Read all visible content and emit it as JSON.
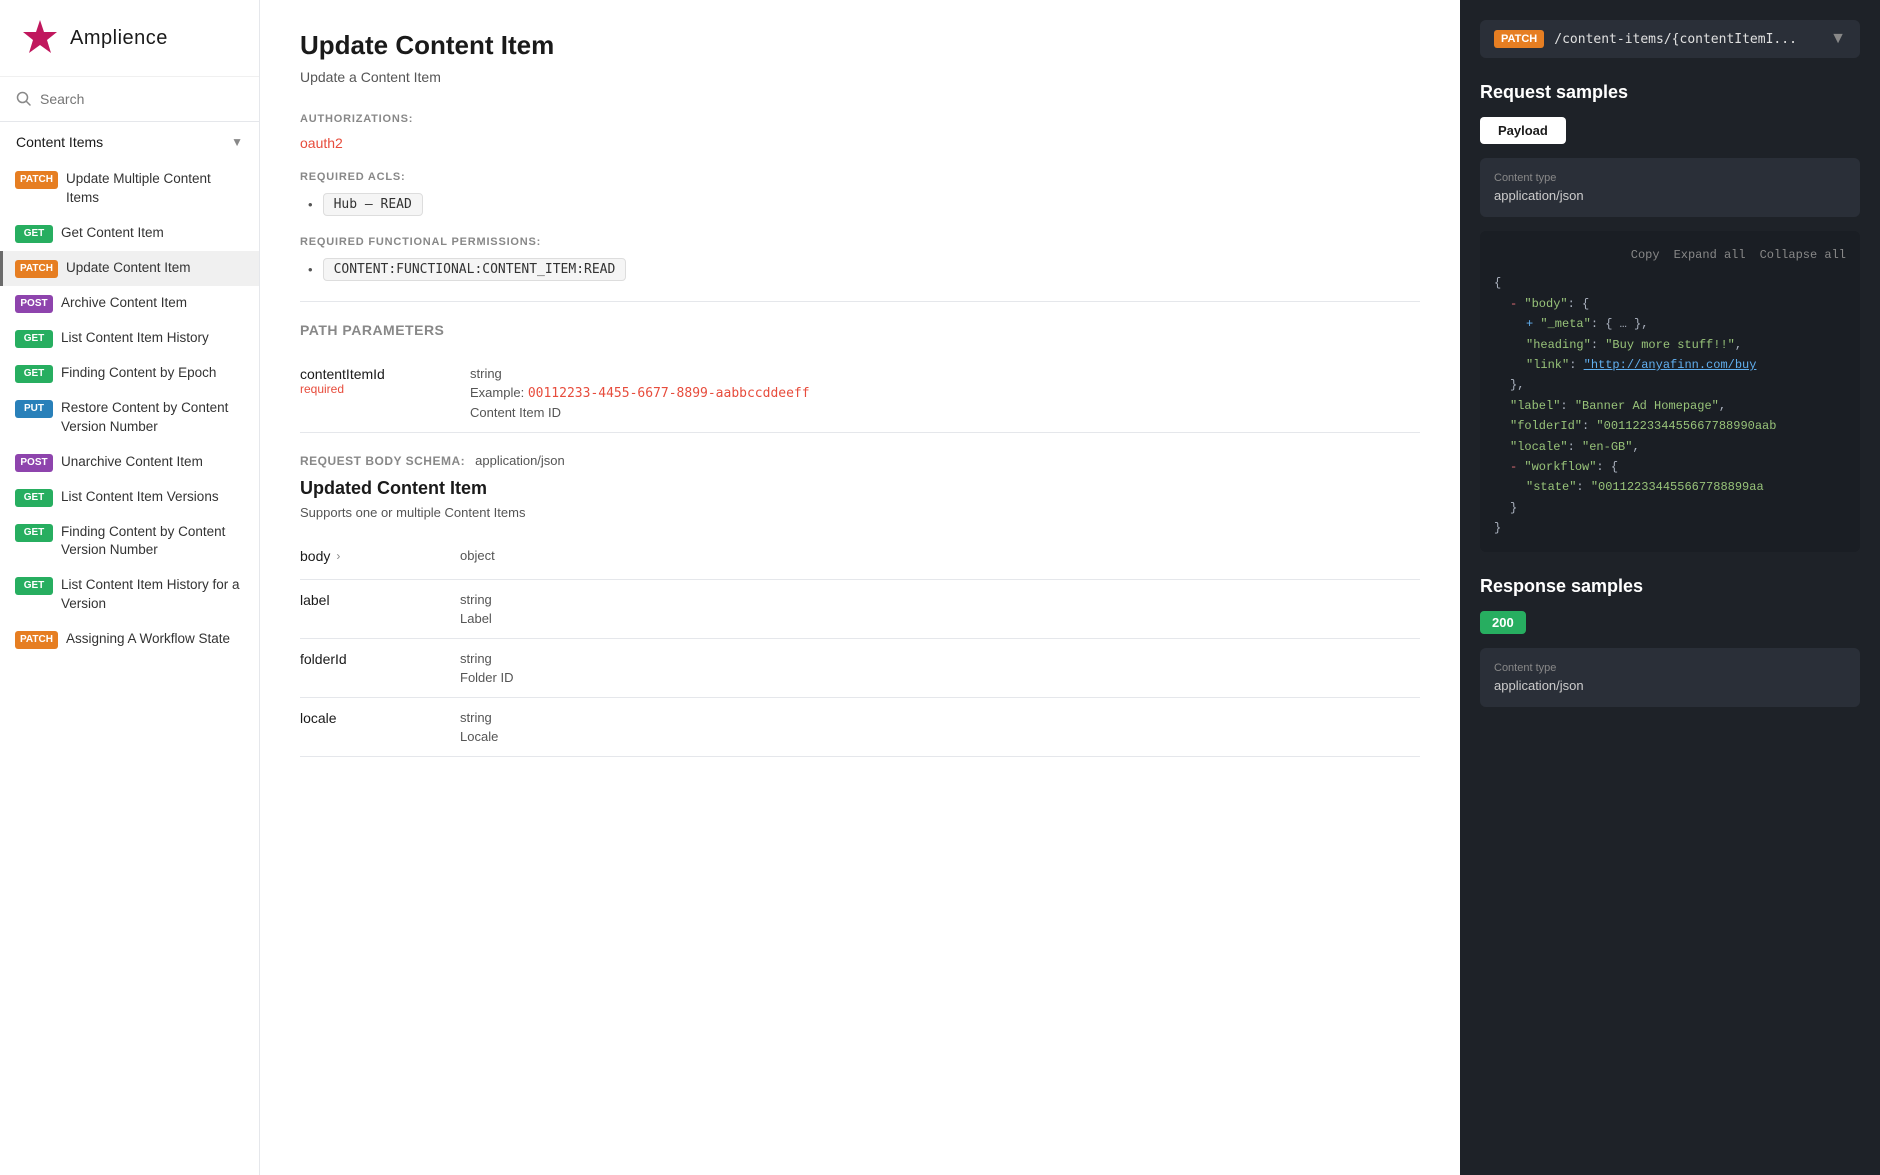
{
  "logo": {
    "text": "Amplience"
  },
  "search": {
    "placeholder": "Search",
    "label": "Search"
  },
  "sidebar": {
    "section_label": "Content Items",
    "items": [
      {
        "id": "update-multiple",
        "method": "PATCH",
        "badge": "patch",
        "label": "Update Multiple Content Items"
      },
      {
        "id": "get-content-item",
        "method": "GET",
        "badge": "get",
        "label": "Get Content Item"
      },
      {
        "id": "update-content-item",
        "method": "PATCH",
        "badge": "patch",
        "label": "Update Content Item",
        "active": true
      },
      {
        "id": "archive-content-item",
        "method": "POST",
        "badge": "post",
        "label": "Archive Content Item"
      },
      {
        "id": "list-history",
        "method": "GET",
        "badge": "get",
        "label": "List Content Item History"
      },
      {
        "id": "finding-by-epoch",
        "method": "GET",
        "badge": "get",
        "label": "Finding Content by Epoch"
      },
      {
        "id": "restore-content",
        "method": "PUT",
        "badge": "put",
        "label": "Restore Content by Content Version Number"
      },
      {
        "id": "unarchive",
        "method": "POST",
        "badge": "post",
        "label": "Unarchive Content Item"
      },
      {
        "id": "list-versions",
        "method": "GET",
        "badge": "get",
        "label": "List Content Item Versions"
      },
      {
        "id": "finding-by-version",
        "method": "GET",
        "badge": "get",
        "label": "Finding Content by Content Version Number"
      },
      {
        "id": "list-history-version",
        "method": "GET",
        "badge": "get",
        "label": "List Content Item History for a Version"
      },
      {
        "id": "assigning-workflow",
        "method": "PATCH",
        "badge": "patch",
        "label": "Assigning A Workflow State"
      }
    ]
  },
  "main": {
    "title": "Update Content Item",
    "subtitle": "Update a Content Item",
    "authorizations_label": "AUTHORIZATIONS:",
    "auth_value": "oauth2",
    "required_acls_label": "REQUIRED ACLS:",
    "acl_value": "Hub – READ",
    "required_perms_label": "REQUIRED FUNCTIONAL PERMISSIONS:",
    "perm_value": "CONTENT:FUNCTIONAL:CONTENT_ITEM:READ",
    "path_params_label": "PATH PARAMETERS",
    "params": [
      {
        "name": "contentItemId",
        "required": "required",
        "type": "string",
        "example_label": "Example:",
        "example_value": "00112233-4455-6677-8899-aabbccddeeff",
        "description": "Content Item ID"
      }
    ],
    "request_body_schema_label": "REQUEST BODY SCHEMA:",
    "request_body_schema_value": "application/json",
    "body_title": "Updated Content Item",
    "body_subtitle": "Supports one or multiple Content Items",
    "body_params": [
      {
        "name": "body",
        "has_expand": true,
        "type": "object",
        "description": ""
      },
      {
        "name": "label",
        "has_expand": false,
        "type": "string",
        "description": "Label"
      },
      {
        "name": "folderId",
        "has_expand": false,
        "type": "string",
        "description": "Folder ID"
      },
      {
        "name": "locale",
        "has_expand": false,
        "type": "string",
        "description": "Locale"
      }
    ]
  },
  "right_panel": {
    "endpoint_method": "PATCH",
    "endpoint_path": "/content-items/{contentItemI...",
    "request_samples_title": "Request samples",
    "payload_tab": "Payload",
    "code_toolbar": {
      "copy": "Copy",
      "expand_all": "Expand all",
      "collapse_all": "Collapse all"
    },
    "content_type_label": "Content type",
    "content_type_value": "application/json",
    "code_lines": [
      {
        "indent": 0,
        "text": "{"
      },
      {
        "indent": 1,
        "prefix": "- ",
        "key": "\"body\"",
        "text": ": {"
      },
      {
        "indent": 2,
        "prefix": "+ ",
        "key": "\"_meta\"",
        "text": ": { … },"
      },
      {
        "indent": 2,
        "key": "\"heading\"",
        "text": ": ",
        "val": "\"Buy more stuff!!\"",
        "suffix": ","
      },
      {
        "indent": 2,
        "key": "\"link\"",
        "text": ": ",
        "url": "\"http://anyafinn.com/buy"
      },
      {
        "indent": 1,
        "text": "},"
      },
      {
        "indent": 1,
        "key": "\"label\"",
        "text": ": ",
        "val": "\"Banner Ad Homepage\"",
        "suffix": ","
      },
      {
        "indent": 1,
        "key": "\"folderId\"",
        "text": ": ",
        "val": "\"001122334455667788990aab",
        "suffix": ""
      },
      {
        "indent": 1,
        "key": "\"locale\"",
        "text": ": ",
        "val": "\"en-GB\"",
        "suffix": ","
      },
      {
        "indent": 1,
        "prefix": "- ",
        "key": "\"workflow\"",
        "text": ": {"
      },
      {
        "indent": 2,
        "key": "\"state\"",
        "text": ": ",
        "val": "\"001122334455667788899aa"
      },
      {
        "indent": 1,
        "text": "}"
      },
      {
        "indent": 0,
        "text": "}"
      }
    ],
    "response_samples_title": "Response samples",
    "response_status": "200",
    "response_content_type_label": "Content type",
    "response_content_type_value": "application/json"
  }
}
